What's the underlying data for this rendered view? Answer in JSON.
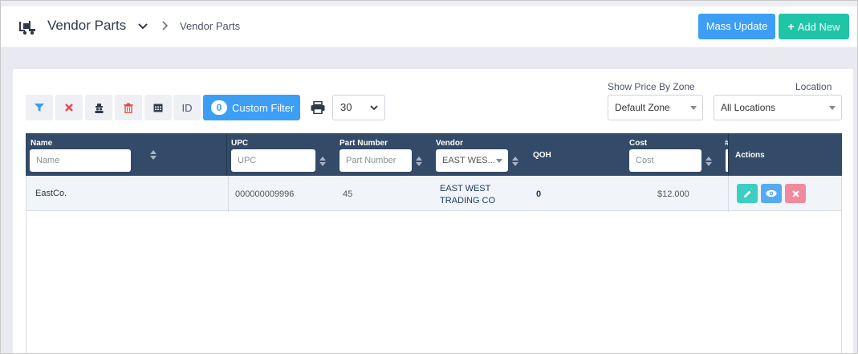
{
  "header": {
    "app_icon": "forklift-icon",
    "title": "Vendor Parts",
    "breadcrumb": "Vendor Parts",
    "mass_update_label": "Mass Update",
    "add_new_label": "Add New"
  },
  "toolbar": {
    "icons": [
      "filter-icon",
      "clear-filter-icon",
      "spy-icon",
      "trash-icon",
      "calendar-icon"
    ],
    "id_label": "ID",
    "custom_filter_count": "0",
    "custom_filter_label": "Custom Filter",
    "page_size": "30",
    "price_zone_label": "Show Price By Zone",
    "price_zone_value": "Default Zone",
    "location_label": "Location",
    "location_value": "All Locations"
  },
  "colors": {
    "primary": "#3d9ef6",
    "success": "#20c5a8",
    "header_bg": "#334a68",
    "danger": "#f08a9c",
    "edit": "#3ccfc1",
    "view": "#55aaf2"
  },
  "table": {
    "columns": {
      "name": {
        "label": "Name",
        "placeholder": "Name"
      },
      "upc": {
        "label": "UPC",
        "placeholder": "UPC"
      },
      "part_number": {
        "label": "Part Number",
        "placeholder": "Part Number"
      },
      "vendor": {
        "label": "Vendor",
        "value": "EAST WES..."
      },
      "qoh": {
        "label": "QOH"
      },
      "cost": {
        "label": "Cost",
        "placeholder": "Cost"
      },
      "hash": {
        "label": "#"
      },
      "actions": {
        "label": "Actions"
      }
    },
    "rows": [
      {
        "name": "EastCo.",
        "upc": "000000009996",
        "part_number": "45",
        "vendor_line1": "EAST WEST",
        "vendor_line2": "TRADING CO",
        "qoh": "0",
        "cost": "$12.000"
      }
    ]
  }
}
